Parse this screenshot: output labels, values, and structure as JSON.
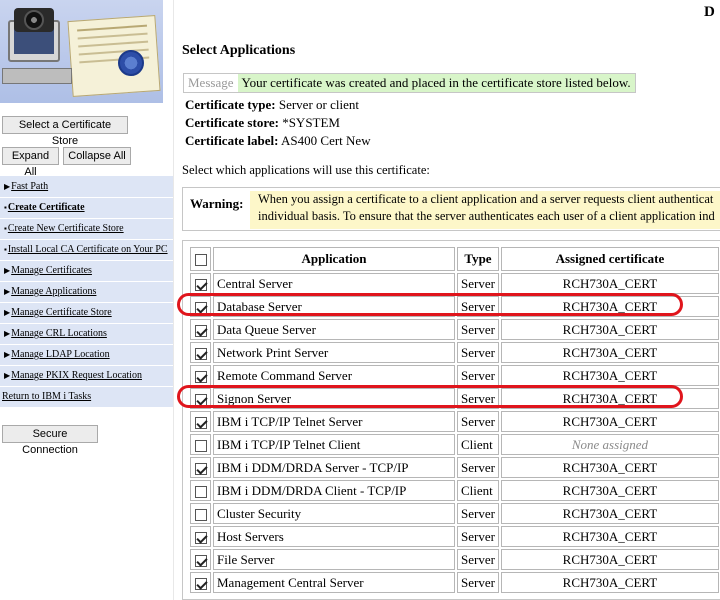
{
  "sidebar": {
    "buttons": {
      "select_store": "Select a Certificate Store",
      "expand_all": "Expand All",
      "collapse_all": "Collapse All",
      "secure_connection": "Secure Connection"
    },
    "nav": [
      {
        "label": "Fast Path",
        "bold": false,
        "arrow": true
      },
      {
        "label": "Create Certificate",
        "bold": true,
        "arrow": false
      },
      {
        "label": "Create New Certificate Store",
        "bold": false,
        "arrow": false
      },
      {
        "label": "Install Local CA Certificate on Your PC",
        "bold": false,
        "arrow": false
      },
      {
        "label": "Manage Certificates",
        "bold": false,
        "arrow": true
      },
      {
        "label": "Manage Applications",
        "bold": false,
        "arrow": true
      },
      {
        "label": "Manage Certificate Store",
        "bold": false,
        "arrow": true
      },
      {
        "label": "Manage CRL Locations",
        "bold": false,
        "arrow": true
      },
      {
        "label": "Manage LDAP Location",
        "bold": false,
        "arrow": true
      },
      {
        "label": "Manage PKIX Request Location",
        "bold": false,
        "arrow": true
      }
    ],
    "return_link": "Return to IBM i Tasks"
  },
  "main": {
    "corner_letter": "D",
    "title": "Select Applications",
    "message": {
      "label": "Message",
      "text": "Your certificate was created and placed in the certificate store listed below."
    },
    "info": {
      "type_label": "Certificate type:",
      "type_value": "Server or client",
      "store_label": "Certificate store:",
      "store_value": "*SYSTEM",
      "label_label": "Certificate label:",
      "label_value": "AS400 Cert New"
    },
    "instruction": "Select which applications will use this certificate:",
    "warning": {
      "label": "Warning:",
      "line1": "When you assign a certificate to a client application and a server requests client authenticat",
      "line2": "individual basis. To ensure that the server authenticates each user of a client application ind"
    },
    "table": {
      "headers": {
        "application": "Application",
        "type": "Type",
        "assigned": "Assigned certificate"
      },
      "rows": [
        {
          "checked": true,
          "app": "Central Server",
          "type": "Server",
          "cert": "RCH730A_CERT"
        },
        {
          "checked": true,
          "app": "Database Server",
          "type": "Server",
          "cert": "RCH730A_CERT"
        },
        {
          "checked": true,
          "app": "Data Queue Server",
          "type": "Server",
          "cert": "RCH730A_CERT"
        },
        {
          "checked": true,
          "app": "Network Print Server",
          "type": "Server",
          "cert": "RCH730A_CERT"
        },
        {
          "checked": true,
          "app": "Remote Command Server",
          "type": "Server",
          "cert": "RCH730A_CERT"
        },
        {
          "checked": true,
          "app": "Signon Server",
          "type": "Server",
          "cert": "RCH730A_CERT"
        },
        {
          "checked": true,
          "app": "IBM i TCP/IP Telnet Server",
          "type": "Server",
          "cert": "RCH730A_CERT"
        },
        {
          "checked": false,
          "app": "IBM i TCP/IP Telnet Client",
          "type": "Client",
          "cert": "None assigned"
        },
        {
          "checked": true,
          "app": "IBM i DDM/DRDA Server - TCP/IP",
          "type": "Server",
          "cert": "RCH730A_CERT"
        },
        {
          "checked": false,
          "app": "IBM i DDM/DRDA Client - TCP/IP",
          "type": "Client",
          "cert": "RCH730A_CERT"
        },
        {
          "checked": false,
          "app": "Cluster Security",
          "type": "Server",
          "cert": "RCH730A_CERT"
        },
        {
          "checked": true,
          "app": "Host Servers",
          "type": "Server",
          "cert": "RCH730A_CERT"
        },
        {
          "checked": true,
          "app": "File Server",
          "type": "Server",
          "cert": "RCH730A_CERT"
        },
        {
          "checked": true,
          "app": "Management Central Server",
          "type": "Server",
          "cert": "RCH730A_CERT"
        }
      ]
    },
    "highlight_color": "#e0151c"
  }
}
